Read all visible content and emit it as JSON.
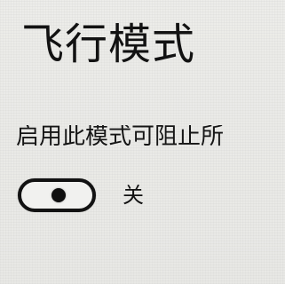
{
  "settings": {
    "title": "飞行模式",
    "description": "启用此模式可阻止所",
    "airplane_mode_toggle": {
      "state_label": "关",
      "value": "off"
    }
  },
  "colors": {
    "background": "#ebebe8",
    "text": "#121212",
    "toggle_border": "#121212",
    "toggle_fill": "#f1f1ef"
  }
}
